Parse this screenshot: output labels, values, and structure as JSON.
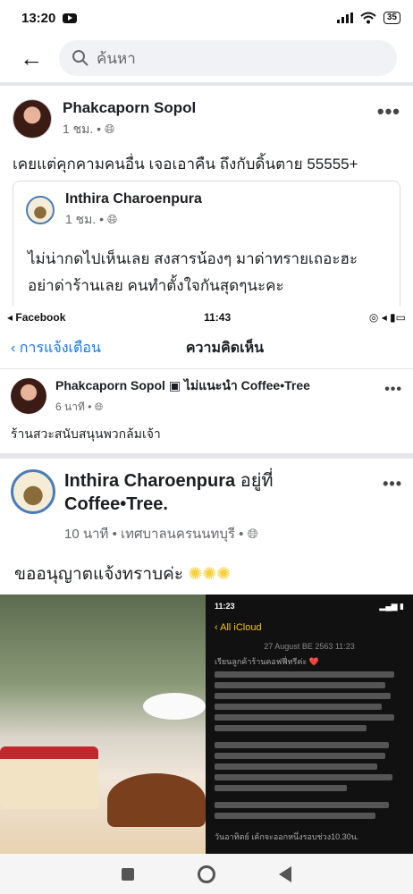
{
  "status_bar": {
    "time": "13:20",
    "battery": "35"
  },
  "search": {
    "placeholder": "ค้นหา"
  },
  "post": {
    "author": "Phakcaporn Sopol",
    "meta": "1 ชม. •",
    "text": "เคยแต่คุกคามคนอื่น เจอเอาคืน ถึงกับดิ้นตาย 55555+",
    "shared": {
      "author": "Inthira Charoenpura",
      "meta": "1 ชม. •",
      "text_line1": "ไม่น่ากดไปเห็นเลย สงสารน้องๆ มาด่าทรายเถอะฮะ",
      "text_line2": "อย่าด่าร้านเลย คนทำตั้งใจกันสุดๆนะคะ"
    }
  },
  "embedded": {
    "status_left": "◂ Facebook",
    "status_time": "11:43",
    "back_label": "การแจ้งเตือน",
    "title": "ความคิดเห็น",
    "comment_author": "Phakcaporn Sopol",
    "comment_tag": "ไม่แนะนำ Coffee•Tree",
    "comment_meta": "6 นาที •",
    "comment_text": "ร้านสวะสนับสนุนพวกล้มเจ้า",
    "inner_author": "Inthira Charoenpura",
    "inner_at": "อยู่ที่",
    "inner_place": "Coffee•Tree.",
    "inner_meta": "10 นาที • เทศบาลนครนนทบุรี •",
    "inner_text": "ขออนุญาตแจ้งทราบค่ะ",
    "phone_time": "11:23",
    "phone_back": "‹ All iCloud",
    "phone_date": "27 August BE 2563 11:23",
    "phone_heading": "เรียนลูกค้าร้านคอฟฟี่ทรีค่ะ ❤️",
    "phone_footer": "วันอาทิตย์ เค้กจะออกหนึ่งรอบช่วง10.30น."
  }
}
